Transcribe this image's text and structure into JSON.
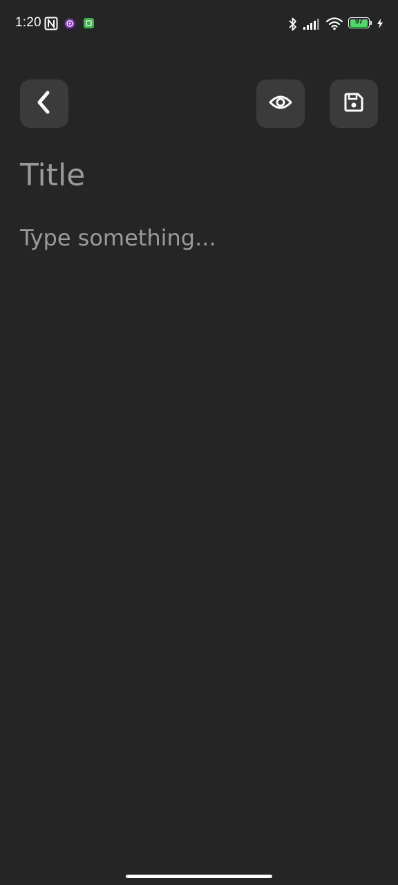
{
  "status_bar": {
    "time": "1:20",
    "battery_level": "97",
    "icons": [
      "nfc-icon",
      "app-notification-icon",
      "app-notification-icon",
      "bluetooth-icon",
      "cellular-signal-icon",
      "wifi-icon",
      "battery-icon",
      "charging-icon"
    ],
    "battery_color": "#4cd964"
  },
  "toolbar": {
    "back_icon": "chevron-left-icon",
    "preview_icon": "eye-icon",
    "save_icon": "floppy-disk-icon",
    "button_color": "#3b3b3b"
  },
  "editor": {
    "title_placeholder": "Title",
    "body_placeholder": "Type something...",
    "title_value": "",
    "body_value": ""
  },
  "theme": {
    "background": "#252525",
    "placeholder_color": "#9a9a9a"
  }
}
